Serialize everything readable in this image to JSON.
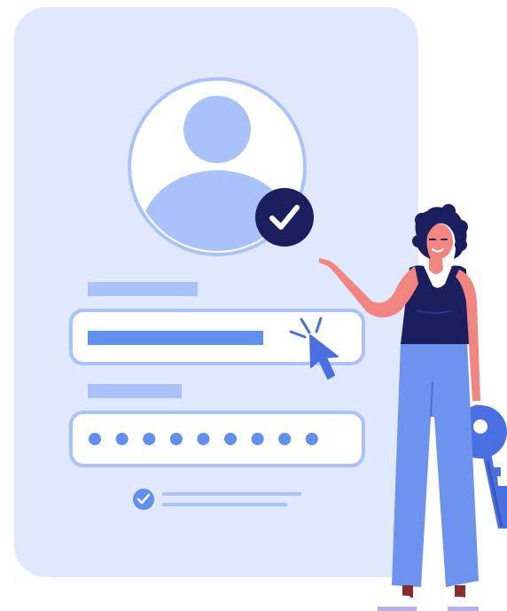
{
  "illustration": {
    "subject": "login-form",
    "form_fields": [
      {
        "type": "username",
        "state": "filled"
      },
      {
        "type": "password",
        "masked_dots": 9
      }
    ],
    "verified": true,
    "remember_checked": true
  },
  "colors": {
    "card": "#dfe8fc",
    "avatar_ring": "#a9c2fb",
    "avatar_fill": "#a9c2fb",
    "label_bar": "#a9c2fb",
    "field_border": "#a9c2fb",
    "field_fill": "#ffffff",
    "field_text_bar": "#5f8fef",
    "password_dot": "#5f8fef",
    "check_badge": "#1b1f5e",
    "cursor": "#4a6fe0",
    "key": "#4a6fe0",
    "skin": "#f0867f",
    "hair": "#1b1f5e",
    "tank_top": "#1b1f5e",
    "pants": "#6d93ef"
  }
}
